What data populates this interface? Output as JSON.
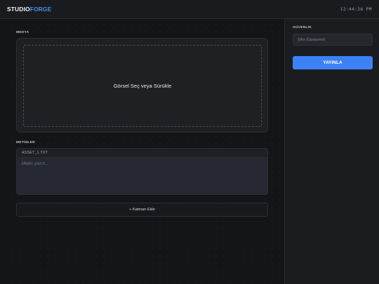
{
  "header": {
    "brand_part1": "STUDIO",
    "brand_part2": "FORGE",
    "clock": "12:44:26 PM"
  },
  "media": {
    "label": "MEDYA",
    "dropzone_text": "Görsel Seç veya Sürükle"
  },
  "texts": {
    "label": "METİNLER",
    "asset_name": "ASSET_1.TXT",
    "placeholder": "Metin yazın..."
  },
  "add_layer_label": "+ Katman Ekle",
  "security": {
    "label": "GÜVENLİK",
    "password_placeholder": "Şifre (Opsiyonel)",
    "publish_label": "YAYINLA"
  },
  "colors": {
    "accent": "#3b82f6",
    "background": "#141518"
  }
}
